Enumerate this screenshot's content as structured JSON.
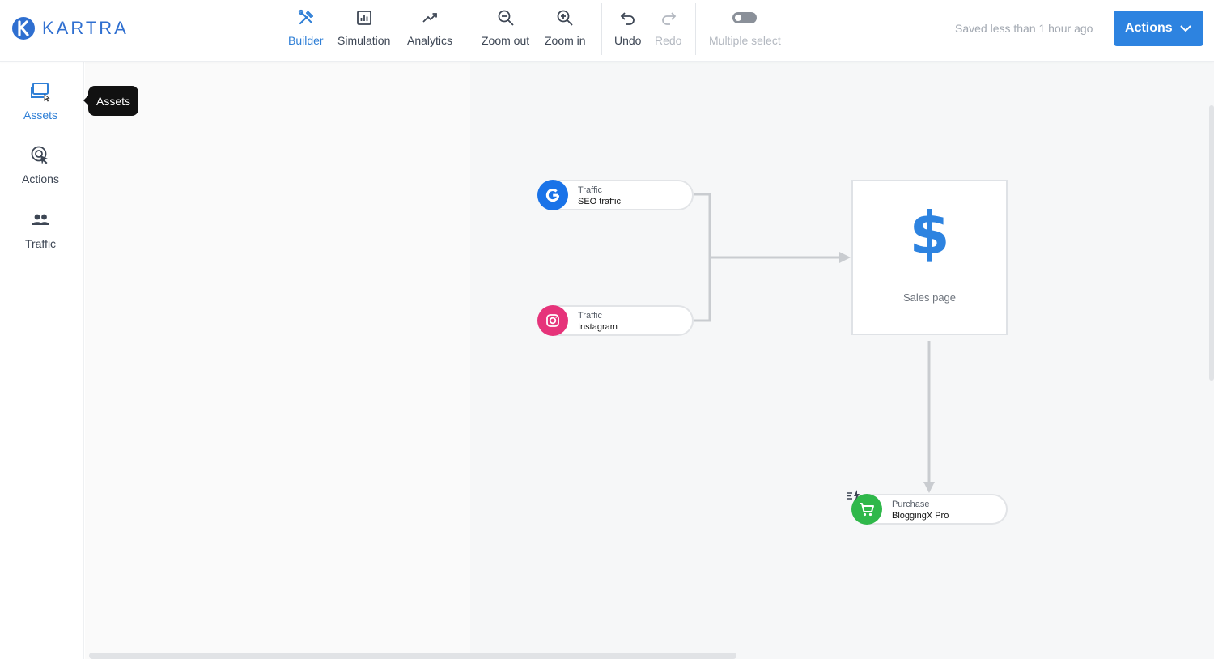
{
  "app": {
    "brand": "KARTRA"
  },
  "toolbar": {
    "builder": "Builder",
    "simulation": "Simulation",
    "analytics": "Analytics",
    "zoom_out": "Zoom out",
    "zoom_in": "Zoom in",
    "undo": "Undo",
    "redo": "Redo",
    "multiple_select": "Multiple select",
    "saved_status": "Saved less than 1 hour ago",
    "actions": "Actions"
  },
  "sidebar": {
    "items": [
      {
        "label": "Assets",
        "icon": "assets-icon",
        "active": true
      },
      {
        "label": "Actions",
        "icon": "actions-icon",
        "active": false
      },
      {
        "label": "Traffic",
        "icon": "traffic-icon",
        "active": false
      }
    ],
    "tooltip": "Assets"
  },
  "canvas": {
    "nodes": {
      "seo": {
        "type": "Traffic",
        "name": "SEO traffic",
        "icon": "google-icon"
      },
      "instagram": {
        "type": "Traffic",
        "name": "Instagram",
        "icon": "instagram-icon"
      },
      "sales_page": {
        "label": "Sales page",
        "icon": "dollar-icon",
        "glyph": "$"
      },
      "purchase": {
        "type": "Purchase",
        "name": "BloggingX Pro",
        "icon": "cart-icon"
      }
    }
  },
  "colors": {
    "accent": "#2d83e0",
    "google": "#1a73e8",
    "instagram": "#e6337a",
    "purchase": "#2fb84a",
    "wire": "#c9ccd0"
  }
}
